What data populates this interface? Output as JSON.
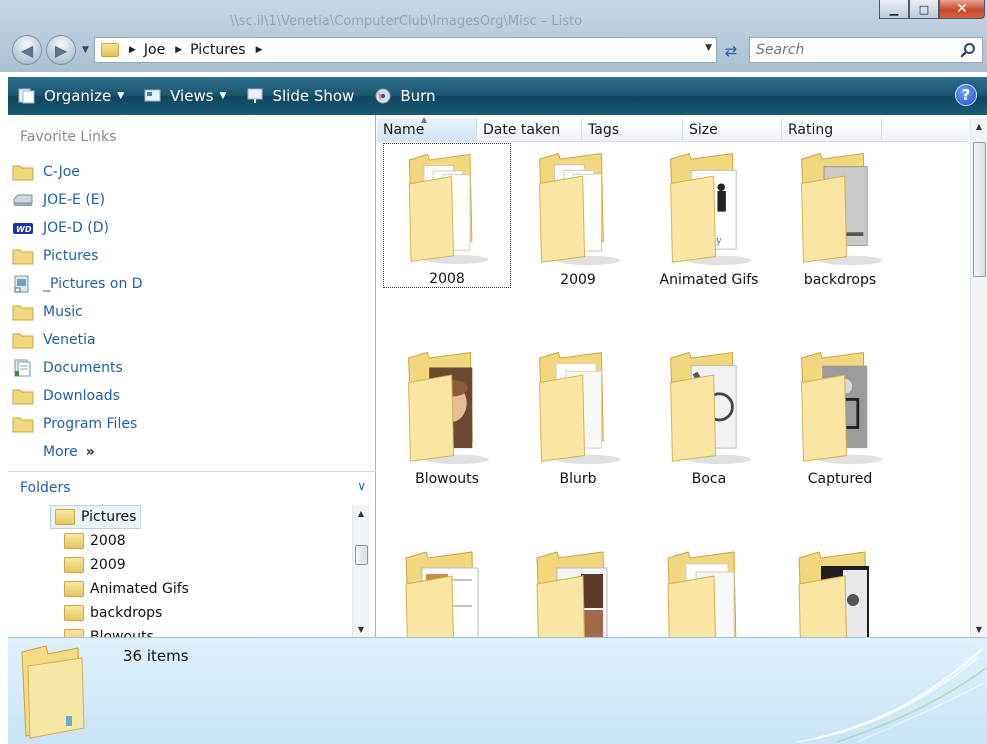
{
  "window": {
    "ghost_title": "\\\\sc.il\\1\\Venetia\\ComputerClub\\ImagesOrg\\Misc – Listo",
    "minimize_label": "▁",
    "maximize_label": "□",
    "close_label": "✕"
  },
  "address": {
    "crumbs": [
      "Joe",
      "Pictures"
    ],
    "search_placeholder": "Search"
  },
  "toolbar": {
    "organize": "Organize",
    "views": "Views",
    "slideshow": "Slide Show",
    "burn": "Burn",
    "help": "?"
  },
  "nav": {
    "favorites_title": "Favorite Links",
    "favorites": [
      {
        "label": "C-Joe",
        "icon": "folder-icon"
      },
      {
        "label": "JOE-E (E)",
        "icon": "drive-icon"
      },
      {
        "label": "JOE-D (D)",
        "icon": "wd-drive-icon"
      },
      {
        "label": "Pictures",
        "icon": "folder-icon"
      },
      {
        "label": "_Pictures on D",
        "icon": "shortcut-icon"
      },
      {
        "label": "Music",
        "icon": "folder-icon"
      },
      {
        "label": "Venetia",
        "icon": "folder-icon"
      },
      {
        "label": "Documents",
        "icon": "documents-icon"
      },
      {
        "label": "Downloads",
        "icon": "folder-icon"
      },
      {
        "label": "Program Files",
        "icon": "folder-icon"
      }
    ],
    "more": "More",
    "more_glyph": "»",
    "folders_title": "Folders",
    "tree": [
      "Pictures",
      "2008",
      "2009",
      "Animated Gifs",
      "backdrops",
      "Blowouts"
    ]
  },
  "columns": [
    "Name",
    "Date taken",
    "Tags",
    "Size",
    "Rating"
  ],
  "tiles": [
    {
      "label": "2008",
      "style": "pages"
    },
    {
      "label": "2009",
      "style": "pages"
    },
    {
      "label": "Animated Gifs",
      "style": "photo-dancers"
    },
    {
      "label": "backdrops",
      "style": "photo-gray"
    },
    {
      "label": "Blowouts",
      "style": "photo-portrait"
    },
    {
      "label": "Blurb",
      "style": "pages-white"
    },
    {
      "label": "Boca",
      "style": "photo-bw"
    },
    {
      "label": "Captured",
      "style": "photo-frame"
    },
    {
      "label": "",
      "style": "photo-beach"
    },
    {
      "label": "",
      "style": "photo-mixed"
    },
    {
      "label": "",
      "style": "pages-white"
    },
    {
      "label": "",
      "style": "photo-street"
    }
  ],
  "details": {
    "count": "36 items"
  },
  "colors": {
    "toolbar": "#1b5671",
    "link": "#1f5fa5",
    "folder": "#f2d77e"
  }
}
